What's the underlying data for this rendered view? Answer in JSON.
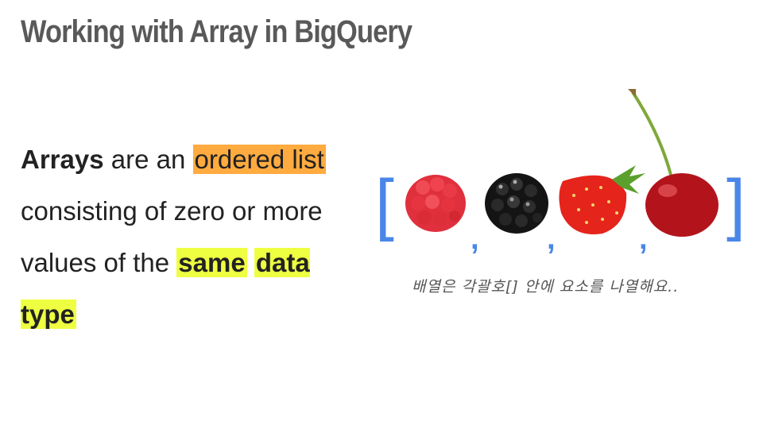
{
  "slide": {
    "title": "Working with Array in BigQuery",
    "body": {
      "w1": "Arrays",
      "w2": " are an ",
      "w3": "ordered list",
      "w4": " consisting of zero or more values of the ",
      "w5": "same",
      "w6": " ",
      "w7": "data type"
    },
    "figure": {
      "open_bracket": "[",
      "close_bracket": "]",
      "comma": ",",
      "fruits": [
        "raspberry-icon",
        "blackberry-icon",
        "strawberry-icon",
        "cherry-icon"
      ]
    },
    "caption": "배열은 각괄호[] 안에 요소를 나열해요.."
  },
  "colors": {
    "title": "#595959",
    "highlight_orange": "#ffab40",
    "highlight_yellow": "#eeff41",
    "bracket_blue": "#4a86e8"
  }
}
